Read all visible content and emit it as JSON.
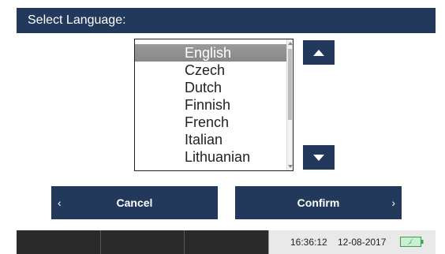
{
  "dialog": {
    "title": "Select Language:"
  },
  "languages": {
    "items": [
      "English",
      "Czech",
      "Dutch",
      "Finnish",
      "French",
      "Italian",
      "Lithuanian"
    ],
    "selected": "English"
  },
  "buttons": {
    "cancel_label": "Cancel",
    "confirm_label": "Confirm",
    "cancel_chevron": "‹",
    "confirm_chevron": "›"
  },
  "status": {
    "time": "16:36:12",
    "date": "12-08-2017"
  },
  "icons": {
    "scroll_up": "triangle-up-icon",
    "scroll_down": "triangle-down-icon",
    "battery": "battery-charging-icon"
  },
  "colors": {
    "accent": "#22395c",
    "selection": "#8f8f8f",
    "battery": "#2fa84f"
  }
}
